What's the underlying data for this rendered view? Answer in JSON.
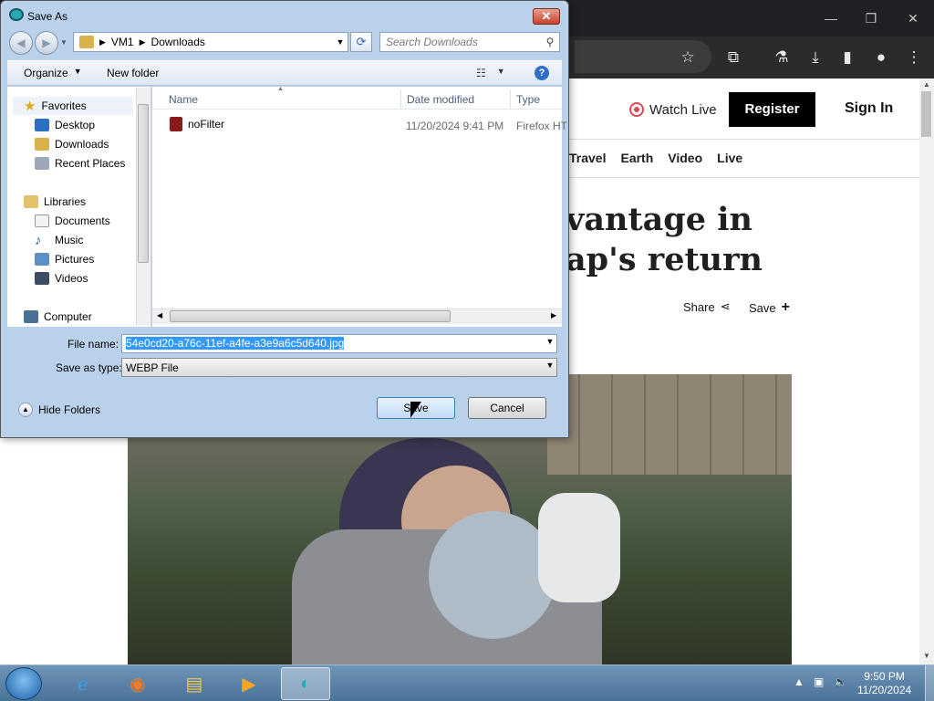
{
  "browser": {
    "page": {
      "watch_live": "Watch Live",
      "register": "Register",
      "sign_in": "Sign In",
      "nav": [
        "Travel",
        "Earth",
        "Video",
        "Live"
      ],
      "headline_line1": "vantage in",
      "headline_line2": "ap's return",
      "share": "Share",
      "save": "Save"
    }
  },
  "dialog": {
    "title": "Save As",
    "close": "✕",
    "address": {
      "segments": [
        "VM1",
        "Downloads"
      ]
    },
    "search_placeholder": "Search Downloads",
    "toolbar": {
      "organize": "Organize",
      "new_folder": "New folder"
    },
    "nav": {
      "favorites": "Favorites",
      "favorites_items": [
        "Desktop",
        "Downloads",
        "Recent Places"
      ],
      "libraries": "Libraries",
      "libraries_items": [
        "Documents",
        "Music",
        "Pictures",
        "Videos"
      ],
      "computer": "Computer"
    },
    "columns": {
      "name": "Name",
      "date": "Date modified",
      "type": "Type"
    },
    "files": [
      {
        "name": "noFilter",
        "date": "11/20/2024 9:41 PM",
        "type": "Firefox HT"
      }
    ],
    "file_name_label": "File name:",
    "file_name_value": "54e0cd20-a76c-11ef-a4fe-a3e9a6c5d640.jpg",
    "save_as_type_label": "Save as type:",
    "save_as_type_value": "WEBP File",
    "hide_folders": "Hide Folders",
    "save_button": "Save",
    "cancel_button": "Cancel"
  },
  "taskbar": {
    "time": "9:50 PM",
    "date": "11/20/2024"
  },
  "colors": {
    "accent": "#3399ff",
    "register_bg": "#000000",
    "live": "#e0475a"
  }
}
